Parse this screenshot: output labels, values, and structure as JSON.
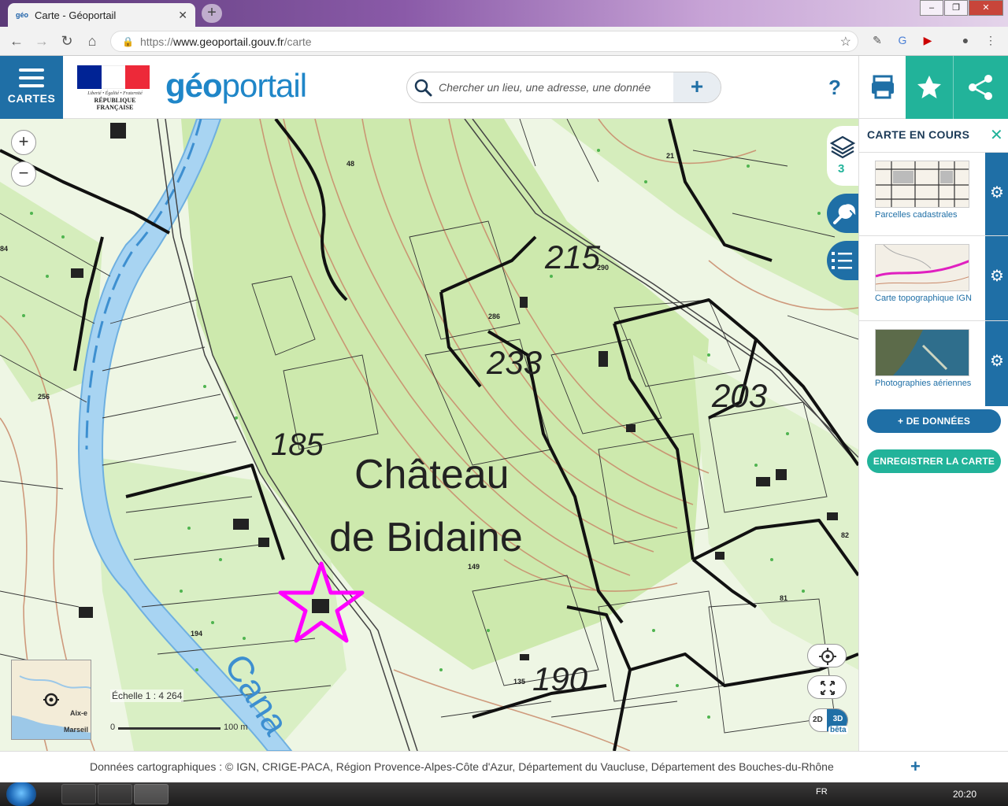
{
  "browser": {
    "tab_title": "Carte - Géoportail",
    "url_scheme": "https://",
    "url_host": "www.geoportail.gouv.fr",
    "url_path": "/carte"
  },
  "header": {
    "menu_label": "CARTES",
    "gov_motto": "Liberté • Égalité • Fraternité",
    "gov_name": "RÉPUBLIQUE FRANÇAISE",
    "logo_geo": "géo",
    "logo_portail": "portail",
    "search_placeholder": "Chercher un lieu, une adresse, une donnée",
    "help_label": "?"
  },
  "map": {
    "place_name_line1": "Château",
    "place_name_line2": "de Bidaine",
    "elevations": [
      "215",
      "233",
      "203",
      "185",
      "190"
    ],
    "canal_text": "Cana",
    "scale_text": "Échelle 1 : 4 264",
    "scale_zero": "0",
    "scale_distance": "100 m",
    "overview_labels": [
      "Aix-e",
      "Marseil"
    ],
    "btn_2d": "2D",
    "btn_3d": "3D",
    "beta_label": "bêta",
    "layer_count": "3",
    "parcel_numbers": [
      "48",
      "21",
      "256",
      "286",
      "290",
      "84",
      "82",
      "81",
      "194",
      "149",
      "135"
    ]
  },
  "panel": {
    "title": "CARTE EN COURS",
    "layers": [
      {
        "name": "Parcelles cadastrales"
      },
      {
        "name": "Carte topographique IGN"
      },
      {
        "name": "Photographies aériennes"
      }
    ],
    "add_data_label": "DE DONNÉES",
    "save_map_label": "ENREGISTRER LA CARTE"
  },
  "footer": {
    "credits": "Données cartographiques : ©  IGN,  CRIGE-PACA,  Région Provence-Alpes-Côte d'Azur,  Département du Vaucluse,  Département des Bouches-du-Rhône",
    "more_label": "+"
  },
  "taskbar": {
    "language": "FR",
    "clock": "20:20"
  },
  "colors": {
    "primary_blue": "#1f6fa6",
    "teal": "#22b39a",
    "forest_green": "#c8e8a8",
    "contour_brown": "#c9896a",
    "marker_magenta": "#ff00ff",
    "canal_blue": "#6fb0e0"
  }
}
